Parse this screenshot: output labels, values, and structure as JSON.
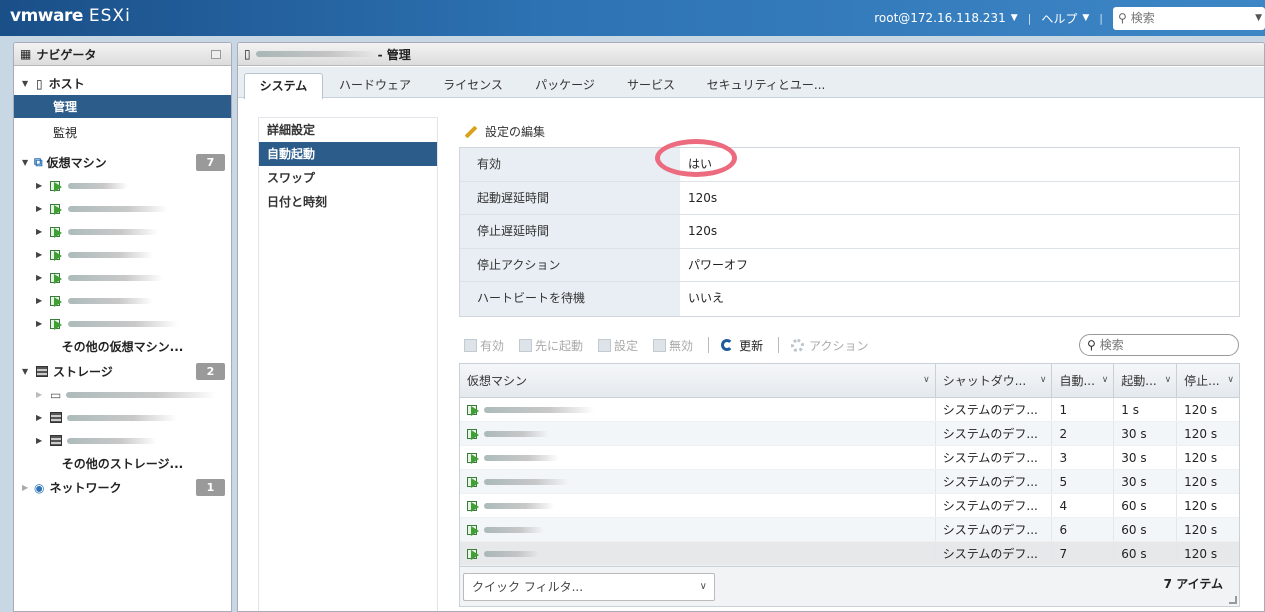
{
  "topbar": {
    "brand_vm": "vmware",
    "brand_product": "ESXi",
    "user": "root@172.16.118.231",
    "help": "ヘルプ",
    "search_placeholder": "検索"
  },
  "navigator": {
    "title": "ナビゲータ",
    "host": {
      "label": "ホスト",
      "children": [
        "管理",
        "監視"
      ]
    },
    "vms": {
      "label": "仮想マシン",
      "count": "7",
      "more": "その他の仮想マシン..."
    },
    "storage": {
      "label": "ストレージ",
      "count": "2",
      "more": "その他のストレージ..."
    },
    "network": {
      "label": "ネットワーク",
      "count": "1"
    }
  },
  "main": {
    "title_suffix": "- 管理",
    "tabs": [
      "システム",
      "ハードウェア",
      "ライセンス",
      "パッケージ",
      "サービス",
      "セキュリティとユー..."
    ],
    "subnav": [
      "詳細設定",
      "自動起動",
      "スワップ",
      "日付と時刻"
    ],
    "edit_label": "設定の編集",
    "props": [
      {
        "key": "有効",
        "value": "はい"
      },
      {
        "key": "起動遅延時間",
        "value": "120s"
      },
      {
        "key": "停止遅延時間",
        "value": "120s"
      },
      {
        "key": "停止アクション",
        "value": "パワーオフ"
      },
      {
        "key": "ハートビートを待機",
        "value": "いいえ"
      }
    ],
    "toolbar": {
      "enable": "有効",
      "first": "先に起動",
      "settings": "設定",
      "disable": "無効",
      "refresh": "更新",
      "actions": "アクション"
    },
    "grid_search_placeholder": "検索",
    "grid": {
      "headers": [
        "仮想マシン",
        "シャットダウ...",
        "自動...",
        "起動...",
        "停止..."
      ],
      "rows": [
        {
          "shutdown": "システムのデフ...",
          "order": "1",
          "start": "1 s",
          "stop": "120 s"
        },
        {
          "shutdown": "システムのデフ...",
          "order": "2",
          "start": "30 s",
          "stop": "120 s"
        },
        {
          "shutdown": "システムのデフ...",
          "order": "3",
          "start": "30 s",
          "stop": "120 s"
        },
        {
          "shutdown": "システムのデフ...",
          "order": "5",
          "start": "30 s",
          "stop": "120 s"
        },
        {
          "shutdown": "システムのデフ...",
          "order": "4",
          "start": "60 s",
          "stop": "120 s"
        },
        {
          "shutdown": "システムのデフ...",
          "order": "6",
          "start": "60 s",
          "stop": "120 s"
        },
        {
          "shutdown": "システムのデフ...",
          "order": "7",
          "start": "60 s",
          "stop": "120 s"
        }
      ],
      "quick_filter": "クイック フィルタ...",
      "count": "7 アイテム"
    }
  }
}
